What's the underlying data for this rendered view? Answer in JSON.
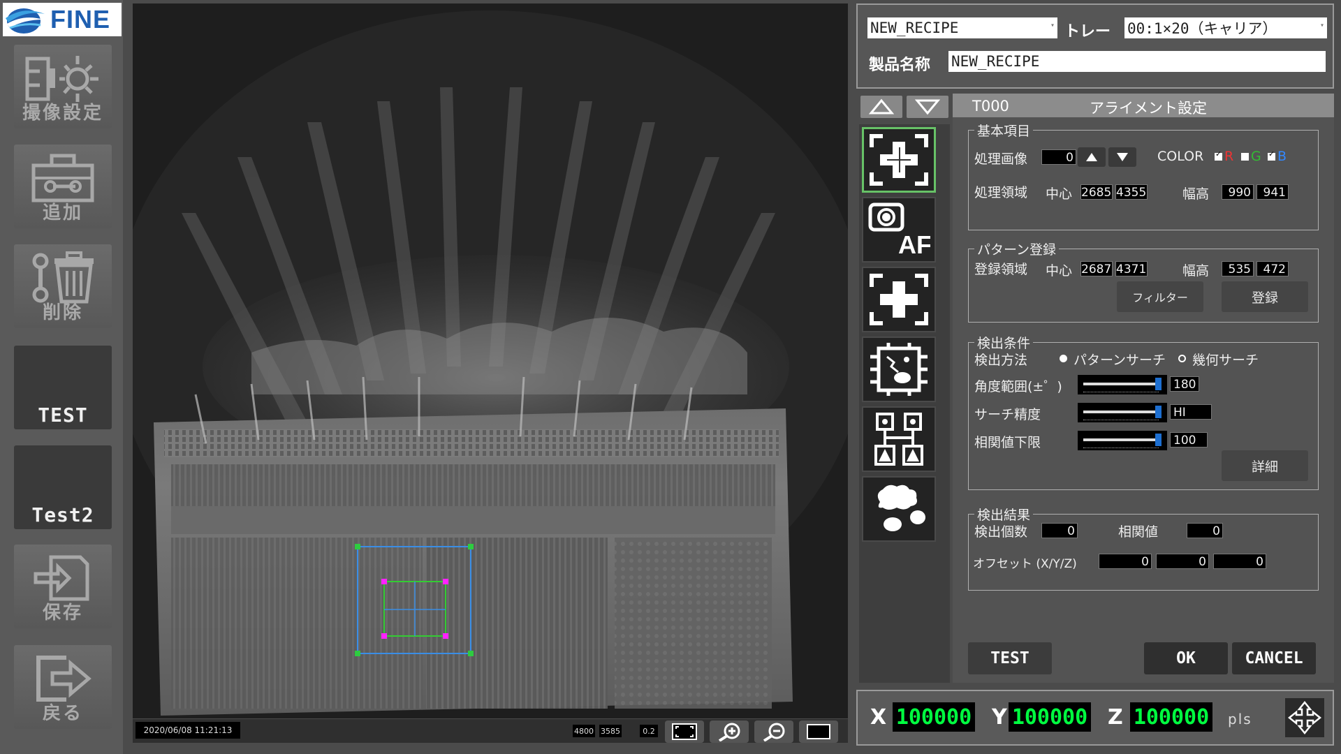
{
  "brand": {
    "logo_text": "FINE"
  },
  "left_toolbar": {
    "camera_settings": "撮像設定",
    "add": "追加",
    "delete": "削除",
    "test": "TEST",
    "test2": "Test2",
    "save": "保存",
    "back": "戻る"
  },
  "view": {
    "timestamp": "2020/06/08 11:21:13",
    "coord_a": "4800",
    "coord_b": "3585",
    "zoom": "0.2"
  },
  "recipe": {
    "recipe_select": "NEW_RECIPE",
    "tray_label": "トレー",
    "tray_select": "00:1×20（キャリア）",
    "product_name_label": "製品名称",
    "product_name": "NEW_RECIPE"
  },
  "settings": {
    "tool_id": "T000",
    "title": "アライメント設定",
    "basic": {
      "group": "基本項目",
      "image_label": "処理画像",
      "image_value": "0",
      "color_label": "COLOR",
      "r": "R",
      "g": "G",
      "b": "B",
      "area_label": "処理領域",
      "center_label": "中心",
      "center_x": "2685",
      "center_y": "4355",
      "size_label": "幅高",
      "width": "990",
      "height": "941"
    },
    "pattern": {
      "group": "パターン登録",
      "area_label": "登録領域",
      "center_label": "中心",
      "center_x": "2687",
      "center_y": "4371",
      "size_label": "幅高",
      "width": "535",
      "height": "472",
      "filter_button": "フィルター",
      "register_button": "登録"
    },
    "detect": {
      "group": "検出条件",
      "method_label": "検出方法",
      "method_pattern": "パターンサーチ",
      "method_geometric": "幾何サーチ",
      "selected_method": "パターンサーチ",
      "angle_label": "角度範囲(±゜)",
      "angle_value": "180",
      "precision_label": "サーチ精度",
      "precision_value": "HI",
      "corr_label": "相関値下限",
      "corr_value": "100",
      "detail_button": "詳細"
    },
    "result": {
      "group": "検出結果",
      "count_label": "検出個数",
      "count_value": "0",
      "corr_label": "相関値",
      "corr_value": "0",
      "offset_label": "オフセット (X/Y/Z)",
      "offset_x": "0",
      "offset_y": "0",
      "offset_z": "0"
    },
    "test_button": "TEST",
    "ok_button": "OK",
    "cancel_button": "CANCEL"
  },
  "stage": {
    "x_label": "X",
    "x_value": "100000",
    "y_label": "Y",
    "y_value": "100000",
    "z_label": "Z",
    "z_value": "100000",
    "unit": "pls"
  },
  "colors": {
    "roi_outer": "#3a8ee6",
    "roi_inner": "#33cc33",
    "roi_handle_outer": "#2ecc40",
    "roi_handle_inner": "#ff22ff",
    "stage_digits": "#00ff40",
    "active_tool": "#67c267"
  }
}
